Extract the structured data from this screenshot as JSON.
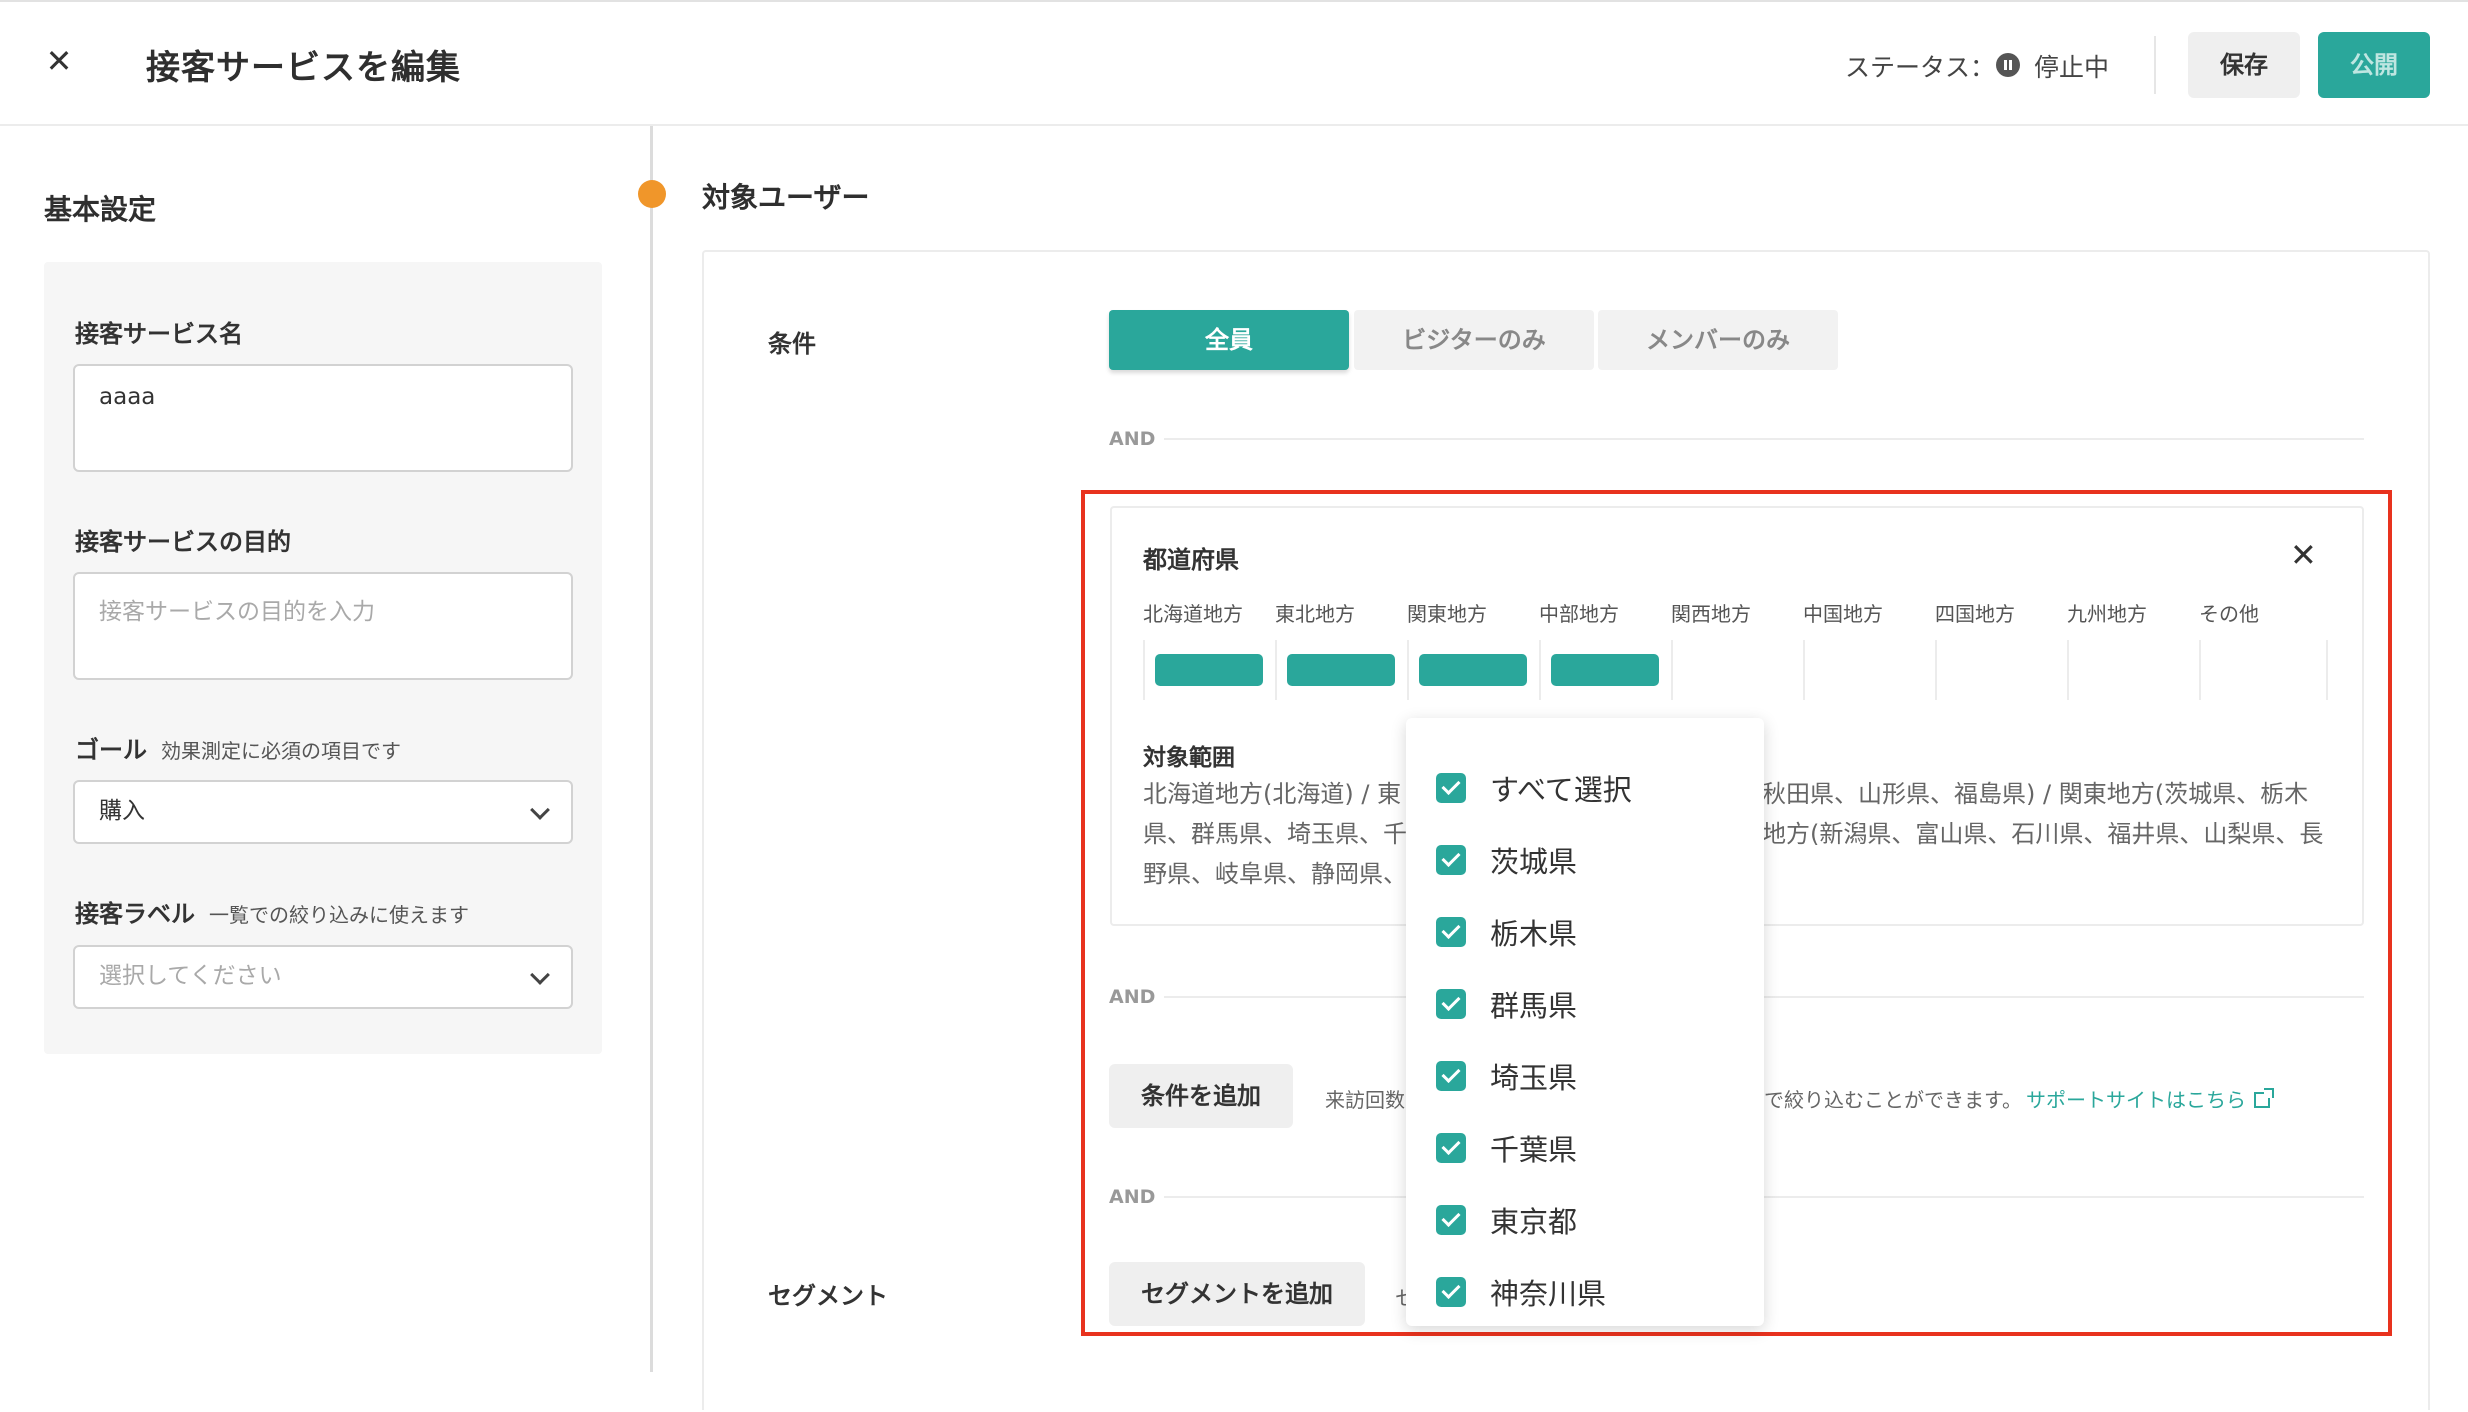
{
  "header": {
    "close_icon": "close-icon",
    "title": "接客サービスを編集",
    "status_label": "ステータス：",
    "status_icon": "pause-circle-icon",
    "status_value": "停止中",
    "save_label": "保存",
    "publish_label": "公開"
  },
  "basic": {
    "title": "基本設定",
    "name_label": "接客サービス名",
    "name_value": "aaaa",
    "purpose_label": "接客サービスの目的",
    "purpose_placeholder": "接客サービスの目的を入力",
    "goal_label": "ゴール",
    "goal_hint": "効果測定に必須の項目です",
    "goal_value": "購入",
    "tag_label": "接客ラベル",
    "tag_hint": "一覧での絞り込みに使えます",
    "tag_placeholder": "選択してください"
  },
  "target": {
    "title": "対象ユーザー",
    "condition_label": "条件",
    "options": [
      "全員",
      "ビジターのみ",
      "メンバーのみ"
    ],
    "selected_option": "全員",
    "and_label": "AND",
    "prefecture": {
      "title": "都道府県",
      "close_icon": "close-icon",
      "regions": [
        {
          "label": "北海道地方",
          "selected": true
        },
        {
          "label": "東北地方",
          "selected": true
        },
        {
          "label": "関東地方",
          "selected": true
        },
        {
          "label": "中部地方",
          "selected": true
        },
        {
          "label": "関西地方",
          "selected": false
        },
        {
          "label": "中国地方",
          "selected": false
        },
        {
          "label": "四国地方",
          "selected": false
        },
        {
          "label": "九州地方",
          "selected": false
        },
        {
          "label": "その他",
          "selected": false
        }
      ],
      "scope_title": "対象範囲",
      "scope_left": [
        "北海道地方(北海道) / 東",
        "県、群馬県、埼玉県、千",
        "野県、岐阜県、静岡県、"
      ],
      "scope_right": [
        "秋田県、山形県、福島県) / 関東地方(茨城県、栃木",
        "地方(新潟県、富山県、石川県、福井県、山梨県、長",
        ""
      ]
    },
    "add_condition_label": "条件を追加",
    "add_condition_hint_left": "来訪回数",
    "add_condition_hint_right": "で絞り込むことができます。",
    "support_link": "サポートサイトはこちら",
    "support_icon": "external-link-icon",
    "segment_label": "セグメント",
    "add_segment_label": "セグメントを追加",
    "segment_hint_left": "セ"
  },
  "dropdown": {
    "items": [
      {
        "label": "すべて選択",
        "checked": true
      },
      {
        "label": "茨城県",
        "checked": true
      },
      {
        "label": "栃木県",
        "checked": true
      },
      {
        "label": "群馬県",
        "checked": true
      },
      {
        "label": "埼玉県",
        "checked": true
      },
      {
        "label": "千葉県",
        "checked": true
      },
      {
        "label": "東京都",
        "checked": true
      },
      {
        "label": "神奈川県",
        "checked": true
      }
    ]
  },
  "colors": {
    "accent": "#2aa79b",
    "highlight_border": "#e8321e",
    "timeline_dot": "#f0962a"
  }
}
